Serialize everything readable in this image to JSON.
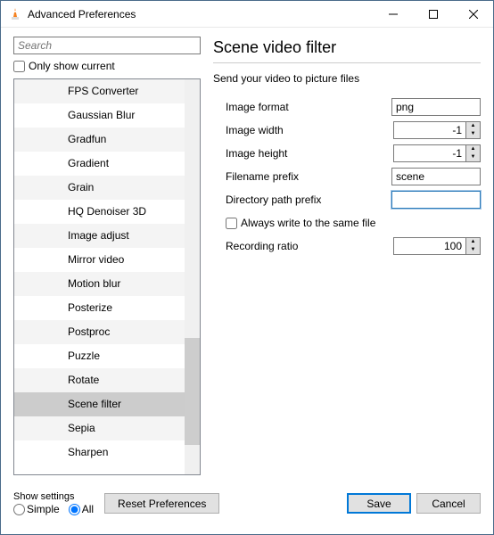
{
  "window": {
    "title": "Advanced Preferences"
  },
  "search": {
    "placeholder": "Search"
  },
  "only_show_current": "Only show current",
  "tree": {
    "items": [
      "FPS Converter",
      "Gaussian Blur",
      "Gradfun",
      "Gradient",
      "Grain",
      "HQ Denoiser 3D",
      "Image adjust",
      "Mirror video",
      "Motion blur",
      "Posterize",
      "Postproc",
      "Puzzle",
      "Rotate",
      "Scene filter",
      "Sepia",
      "Sharpen"
    ],
    "selected_index": 13
  },
  "right": {
    "heading": "Scene video filter",
    "sub": "Send your video to picture files",
    "labels": {
      "format": "Image format",
      "width": "Image width",
      "height": "Image height",
      "fprefix": "Filename prefix",
      "dprefix": "Directory path prefix",
      "always": "Always write to the same file",
      "ratio": "Recording ratio"
    },
    "values": {
      "format": "png",
      "width": "-1",
      "height": "-1",
      "fprefix": "scene",
      "dprefix": "",
      "ratio": "100"
    }
  },
  "bottom": {
    "show_settings": "Show settings",
    "simple": "Simple",
    "all": "All",
    "reset": "Reset Preferences",
    "save": "Save",
    "cancel": "Cancel"
  }
}
